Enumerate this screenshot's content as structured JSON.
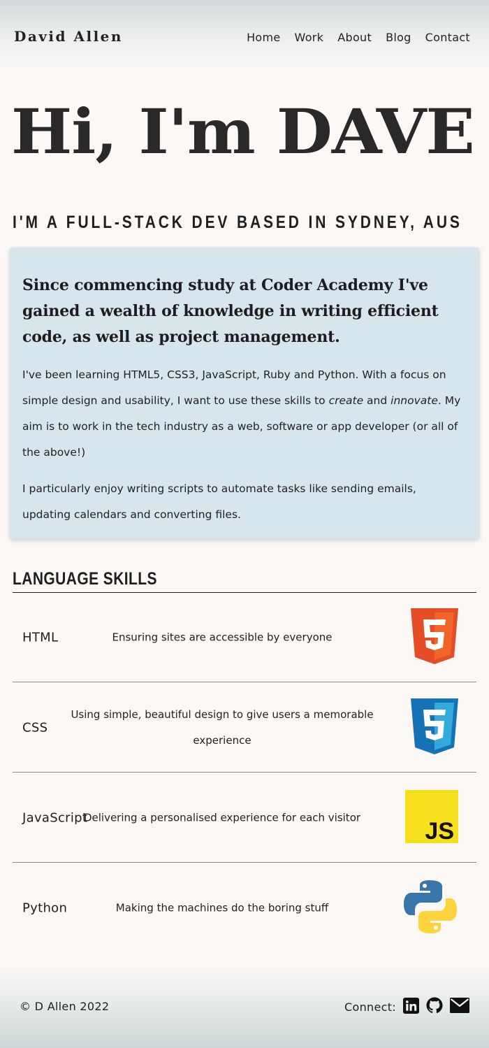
{
  "header": {
    "logo": "David Allen",
    "nav": [
      "Home",
      "Work",
      "About",
      "Blog",
      "Contact"
    ]
  },
  "hero": {
    "title": "Hi, I'm DAVE",
    "subtitle": "I'M A FULL-STACK DEV BASED IN SYDNEY, AUS"
  },
  "intro": {
    "lead": "Since commencing study at Coder Academy I've gained a wealth of knowledge in writing efficient code, as well as project management.",
    "p1_start": "I've been learning HTML5, CSS3, JavaScript, Ruby and Python. With a focus on simple design and usability, I want to use these skills to ",
    "p1_em1": "create",
    "p1_mid": " and ",
    "p1_em2": "innovate",
    "p1_end": ". My aim is to work in the tech industry as a web, software or app developer (or all of the above!)",
    "p2": "I particularly enjoy writing scripts to automate tasks like sending emails, updating calendars and converting files."
  },
  "skills": {
    "title": "LANGUAGE SKILLS",
    "items": [
      {
        "name": "HTML",
        "desc": "Ensuring sites are accessible by everyone",
        "icon": "html5-icon"
      },
      {
        "name": "CSS",
        "desc": "Using simple, beautiful design to give users a memorable experience",
        "icon": "css3-icon"
      },
      {
        "name": "JavaScript",
        "desc": "Delivering a personalised experience for each visitor",
        "icon": "javascript-icon"
      },
      {
        "name": "Python",
        "desc": "Making the machines do the boring stuff",
        "icon": "python-icon"
      }
    ]
  },
  "footer": {
    "copyright": "© D Allen 2022",
    "connect_label": "Connect:",
    "links": [
      "linkedin-icon",
      "github-icon",
      "email-icon"
    ]
  },
  "colors": {
    "background": "#fbf8f6",
    "intro_card": "#d7e5ec",
    "html5_orange": "#e44d26",
    "css3_blue": "#1572b6",
    "js_yellow": "#f7df1e",
    "python_blue": "#3776ab",
    "python_yellow": "#ffd43b"
  }
}
